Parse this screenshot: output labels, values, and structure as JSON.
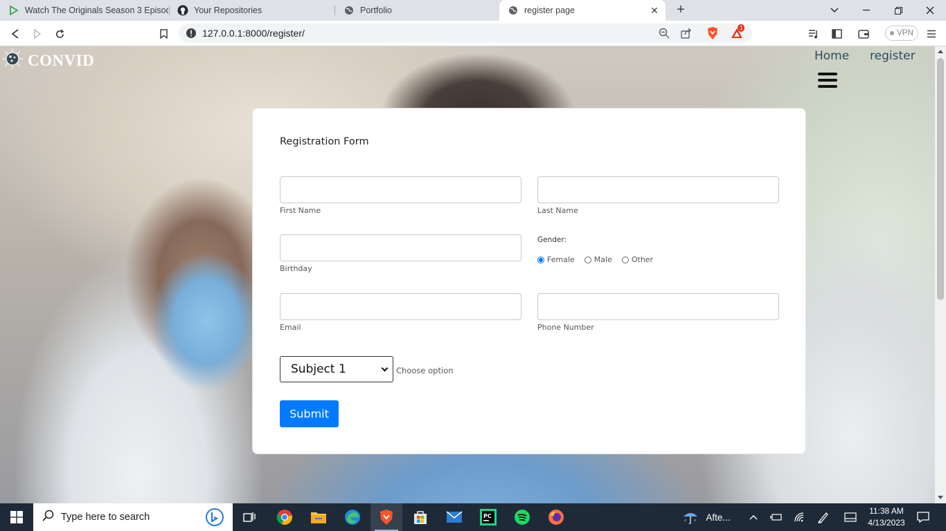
{
  "browser": {
    "tabs": [
      {
        "label": "Watch The Originals Season 3 Episode",
        "icon": "play-icon"
      },
      {
        "label": "Your Repositories",
        "icon": "github-icon"
      },
      {
        "label": "Portfolio",
        "icon": "globe-icon"
      },
      {
        "label": "register page",
        "icon": "globe-icon",
        "active": true
      }
    ],
    "url": "127.0.0.1:8000/register/",
    "vpn_label": "VPN",
    "notification_count": "1"
  },
  "site": {
    "brand": "CONVID",
    "nav": {
      "home": "Home",
      "register": "register"
    }
  },
  "form": {
    "title": "Registration Form",
    "first_name": {
      "label": "First Name",
      "value": ""
    },
    "last_name": {
      "label": "Last Name",
      "value": ""
    },
    "birthday": {
      "label": "Birthday",
      "value": ""
    },
    "gender": {
      "label": "Gender:",
      "options": [
        "Female",
        "Male",
        "Other"
      ],
      "selected": "Female"
    },
    "email": {
      "label": "Email",
      "value": ""
    },
    "phone": {
      "label": "Phone Number",
      "value": ""
    },
    "subject": {
      "selected": "Subject 1",
      "hint": "Choose option"
    },
    "submit_label": "Submit"
  },
  "taskbar": {
    "search_placeholder": "Type here to search",
    "weather": "Afte...",
    "time": "11:38 AM",
    "date": "4/13/2023"
  },
  "colors": {
    "accent": "#007bff",
    "nav_text": "#2b4a5d",
    "taskbar": "#1f2a38"
  }
}
